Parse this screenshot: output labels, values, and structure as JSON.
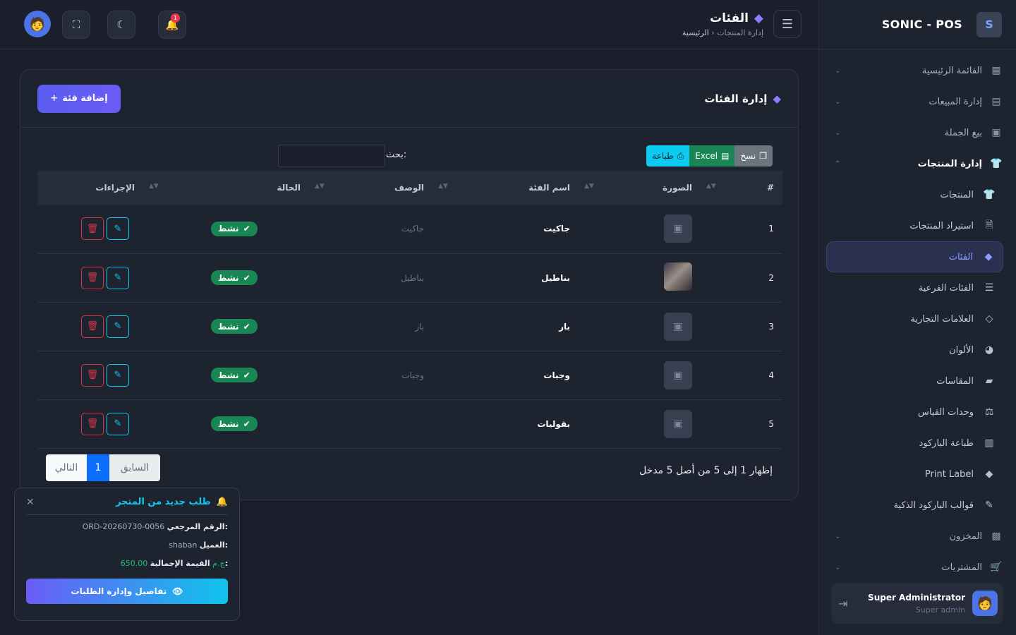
{
  "brand": {
    "name": "SONIC - POS",
    "logo": "S"
  },
  "header": {
    "title": "الفئات",
    "breadcrumb_home": "الرئيسية",
    "breadcrumb_sep": "‹",
    "breadcrumb_current": "إدارة المنتجات",
    "notif_count": "1"
  },
  "sidebar": {
    "top_items": [
      {
        "label": "القائمة الرئيسية",
        "icon": "dashboard-icon"
      },
      {
        "label": "إدارة المبيعات",
        "icon": "cash-register-icon"
      },
      {
        "label": "بيع الجملة",
        "icon": "warehouse-icon"
      }
    ],
    "products_section": {
      "label": "إدارة المنتجات",
      "icon": "shirt-icon"
    },
    "sub_items": [
      {
        "label": "المنتجات",
        "icon": "shirt-icon"
      },
      {
        "label": "استيراد المنتجات",
        "icon": "csv-file-icon"
      },
      {
        "label": "الفئات",
        "icon": "tags-icon"
      },
      {
        "label": "الفئات الفرعية",
        "icon": "list-icon"
      },
      {
        "label": "العلامات التجارية",
        "icon": "gem-icon"
      },
      {
        "label": "الألوان",
        "icon": "palette-icon"
      },
      {
        "label": "المقاسات",
        "icon": "ruler-icon"
      },
      {
        "label": "وحدات القياس",
        "icon": "scale-icon"
      },
      {
        "label": "طباعة الباركود",
        "icon": "barcode-icon"
      },
      {
        "label": "Print Label",
        "icon": "tags-icon"
      },
      {
        "label": "قوالب الباركود الذكية",
        "icon": "pen-icon"
      }
    ],
    "bottom_items": [
      {
        "label": "المخزون",
        "icon": "boxes-icon"
      },
      {
        "label": "المشتريات",
        "icon": "cart-icon"
      }
    ]
  },
  "user": {
    "name": "Super Administrator",
    "role": "Super admin"
  },
  "card": {
    "title": "إدارة الفئات",
    "add_label": "إضافة فئة"
  },
  "export": {
    "copy": "نسخ",
    "excel": "Excel",
    "print": "طباعة"
  },
  "search": {
    "label": "بحث:"
  },
  "table": {
    "headers": [
      "#",
      "الصورة",
      "اسم الفئة",
      "الوصف",
      "الحالة",
      "الإجراءات"
    ],
    "rows": [
      {
        "num": "1",
        "name": "جاكيت",
        "desc": "جاكيت",
        "status": "نشط",
        "photo": false
      },
      {
        "num": "2",
        "name": "بناطيل",
        "desc": "بناطيل",
        "status": "نشط",
        "photo": true
      },
      {
        "num": "3",
        "name": "بار",
        "desc": "بار",
        "status": "نشط",
        "photo": false
      },
      {
        "num": "4",
        "name": "وجبات",
        "desc": "وجبات",
        "status": "نشط",
        "photo": false
      },
      {
        "num": "5",
        "name": "بقوليات",
        "desc": "",
        "status": "نشط",
        "photo": false
      }
    ]
  },
  "pagination": {
    "info": "إظهار 1 إلى 5 من أصل 5 مدخل",
    "prev": "السابق",
    "page": "1",
    "next": "التالي"
  },
  "toast": {
    "title": "طلب جديد من المتجر",
    "ref_label": "الرقم المرجعي:",
    "ref_value": "ORD-20260730-0056",
    "customer_label": "العميل:",
    "customer_value": "shaban",
    "total_label": "القيمة الإجمالية:",
    "total_value": "650.00 ج.م",
    "button": "تفاصيل وإدارة الطلبات"
  }
}
